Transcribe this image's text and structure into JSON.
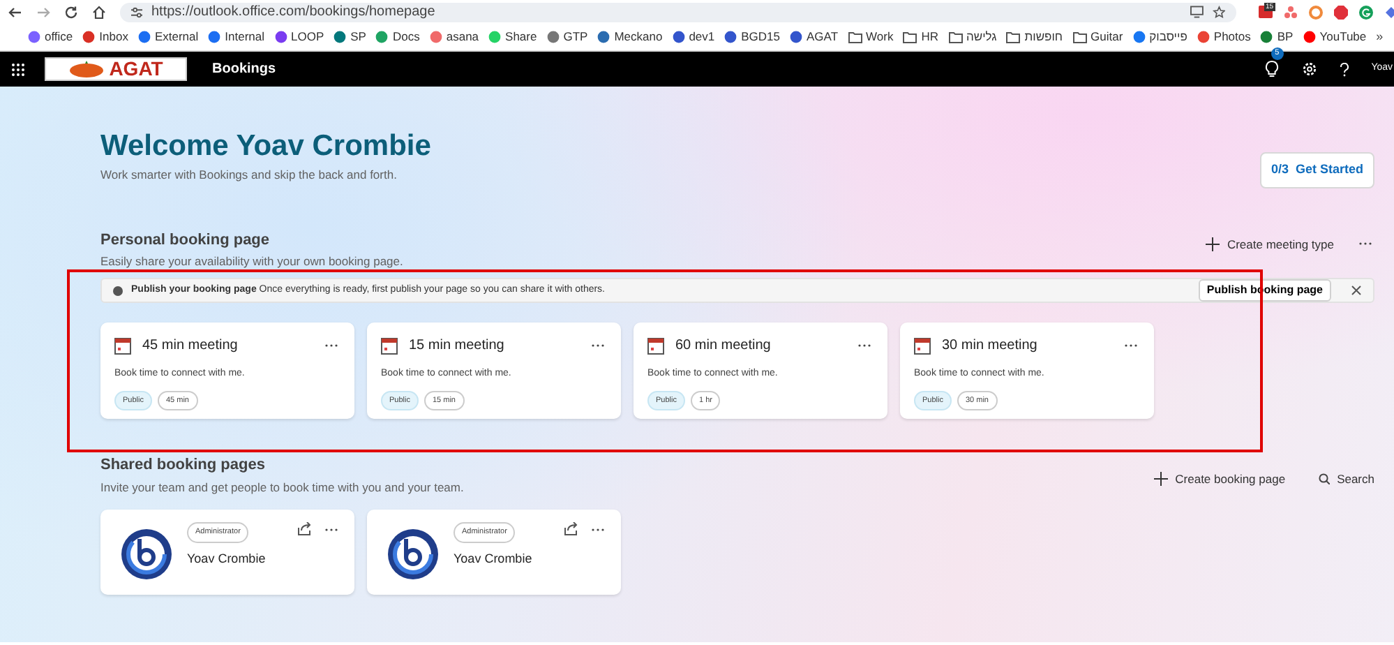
{
  "browser": {
    "url": "https://outlook.office.com/bookings/homepage",
    "extension_badge": "15",
    "bookmarks": [
      {
        "label": "office",
        "kind": "site",
        "color": "#7b61ff"
      },
      {
        "label": "Inbox",
        "kind": "site",
        "color": "#d93025"
      },
      {
        "label": "External",
        "kind": "site",
        "color": "#1c6ef2"
      },
      {
        "label": "Internal",
        "kind": "site",
        "color": "#1c6ef2"
      },
      {
        "label": "LOOP",
        "kind": "site",
        "color": "#7a3cf0"
      },
      {
        "label": "SP",
        "kind": "site",
        "color": "#03787c"
      },
      {
        "label": "Docs",
        "kind": "site",
        "color": "#1fa463"
      },
      {
        "label": "asana",
        "kind": "site",
        "color": "#f06a6a"
      },
      {
        "label": "Share",
        "kind": "site",
        "color": "#25d366"
      },
      {
        "label": "GTP",
        "kind": "site",
        "color": "#777777"
      },
      {
        "label": "Meckano",
        "kind": "site",
        "color": "#2b6cb0"
      },
      {
        "label": "dev1",
        "kind": "site",
        "color": "#3355cc"
      },
      {
        "label": "BGD15",
        "kind": "site",
        "color": "#3355cc"
      },
      {
        "label": "AGAT",
        "kind": "site",
        "color": "#3355cc"
      },
      {
        "label": "Work",
        "kind": "folder"
      },
      {
        "label": "HR",
        "kind": "folder"
      },
      {
        "label": "גלישה",
        "kind": "folder"
      },
      {
        "label": "חופשות",
        "kind": "folder"
      },
      {
        "label": "Guitar",
        "kind": "folder"
      },
      {
        "label": "פייסבוק",
        "kind": "site",
        "color": "#1877f2"
      },
      {
        "label": "Photos",
        "kind": "site",
        "color": "#ea4335"
      },
      {
        "label": "BP",
        "kind": "site",
        "color": "#188038"
      },
      {
        "label": "YouTube",
        "kind": "site",
        "color": "#ff0000"
      }
    ],
    "overflow": "»"
  },
  "app_bar": {
    "logo": "AGAT",
    "app_name": "Bookings",
    "notification_count": "5",
    "user": "Yoav"
  },
  "welcome": {
    "title": "Welcome Yoav Crombie",
    "subtitle": "Work smarter with Bookings and skip the back and forth.",
    "progress": "0/3",
    "get_started": "Get Started"
  },
  "personal": {
    "title": "Personal booking page",
    "subtitle": "Easily share your availability with your own booking page.",
    "create_label": "Create meeting type",
    "banner": {
      "title": "Publish your booking page",
      "message": "Once everything is ready, first publish your page so you can share it with others.",
      "button": "Publish booking page"
    },
    "meetings": [
      {
        "title": "45 min meeting",
        "description": "Book time to connect with me.",
        "visibility": "Public",
        "duration": "45 min"
      },
      {
        "title": "15 min meeting",
        "description": "Book time to connect with me.",
        "visibility": "Public",
        "duration": "15 min"
      },
      {
        "title": "60 min meeting",
        "description": "Book time to connect with me.",
        "visibility": "Public",
        "duration": "1 hr"
      },
      {
        "title": "30 min meeting",
        "description": "Book time to connect with me.",
        "visibility": "Public",
        "duration": "30 min"
      }
    ]
  },
  "shared": {
    "title": "Shared booking pages",
    "subtitle": "Invite your team and get people to book time with you and your team.",
    "create_label": "Create booking page",
    "search_label": "Search",
    "pages": [
      {
        "role": "Administrator",
        "name": "Yoav Crombie"
      },
      {
        "role": "Administrator",
        "name": "Yoav Crombie"
      }
    ]
  }
}
